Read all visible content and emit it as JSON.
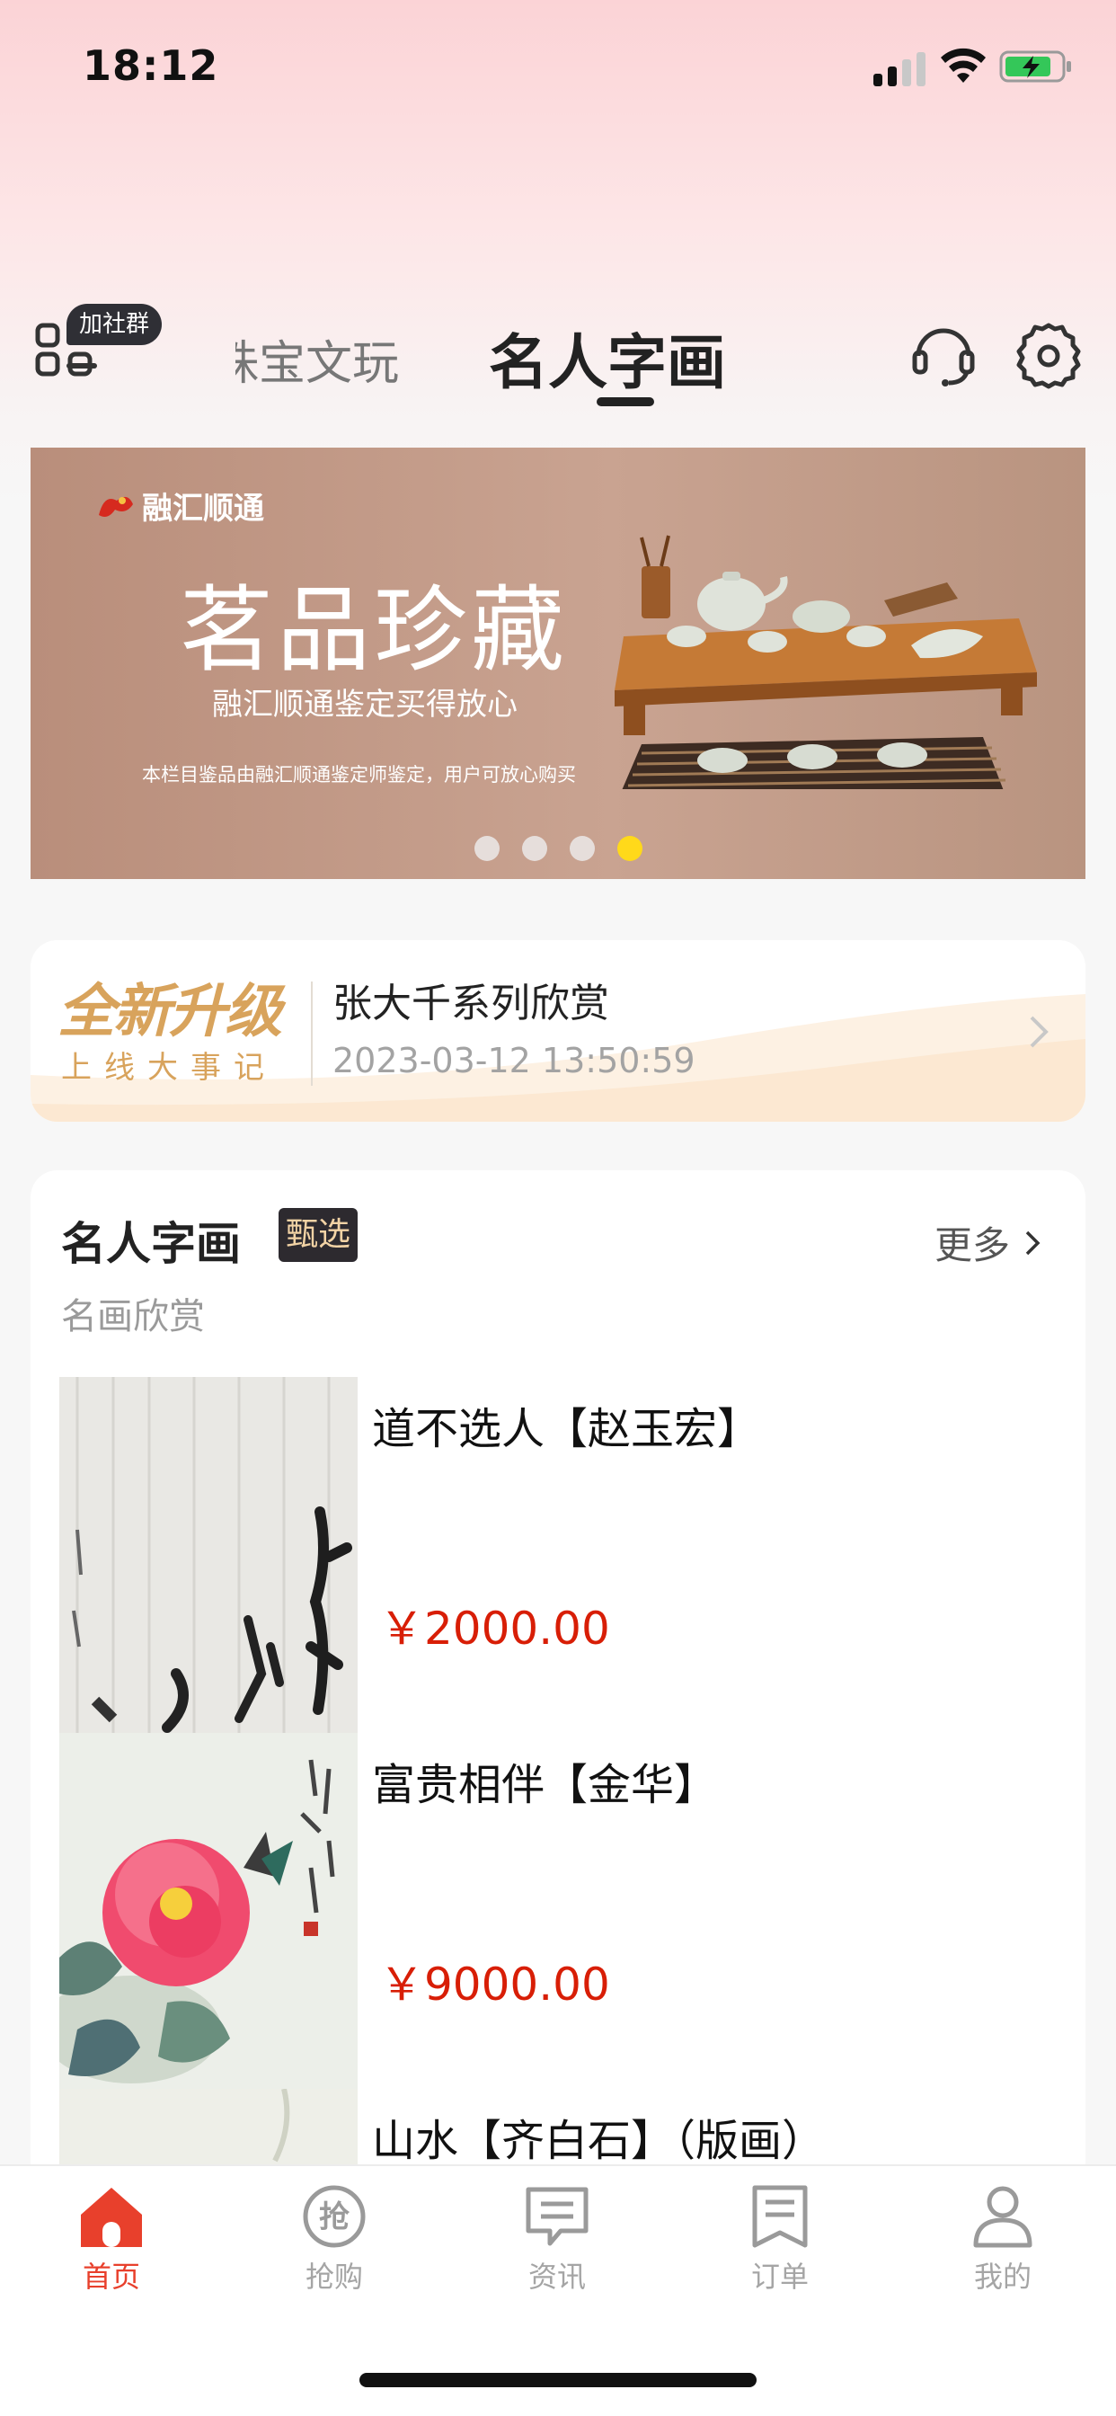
{
  "status_bar": {
    "time": "18:12"
  },
  "header": {
    "group_badge": "加社群",
    "tab_inactive": "珠宝文玩",
    "tab_active": "名人字画"
  },
  "banner": {
    "logo_text": "融汇顺通",
    "title": "茗品珍藏",
    "subtitle": "融汇顺通鉴定买得放心",
    "note": "本栏目鉴品由融汇顺通鉴定师鉴定，用户可放心购买",
    "active_dot": 4,
    "dot_count": 4
  },
  "news": {
    "logo_line1": "全新升级",
    "logo_line2": "上线大事记",
    "title": "张大千系列欣赏",
    "time": "2023-03-12 13:50:59"
  },
  "section": {
    "title": "名人字画",
    "tag": "甄选",
    "more": "更多",
    "subtitle": "名画欣赏",
    "products": [
      {
        "name": "道不选人【赵玉宏】",
        "price": "￥2000.00"
      },
      {
        "name": "富贵相伴【金华】",
        "price": "￥9000.00"
      },
      {
        "name": "山水【齐白石】（版画）",
        "price": ""
      }
    ]
  },
  "tabbar": {
    "items": [
      {
        "label": "首页",
        "icon": "home-icon"
      },
      {
        "label": "抢购",
        "icon": "rush-buy-icon"
      },
      {
        "label": "资讯",
        "icon": "news-icon"
      },
      {
        "label": "订单",
        "icon": "order-icon"
      },
      {
        "label": "我的",
        "icon": "profile-icon"
      }
    ],
    "active_index": 0
  },
  "colors": {
    "accent_red": "#e8402c",
    "price_red": "#d81e06",
    "dot_active": "#ffd91a",
    "badge_dark": "#2f2f35"
  }
}
